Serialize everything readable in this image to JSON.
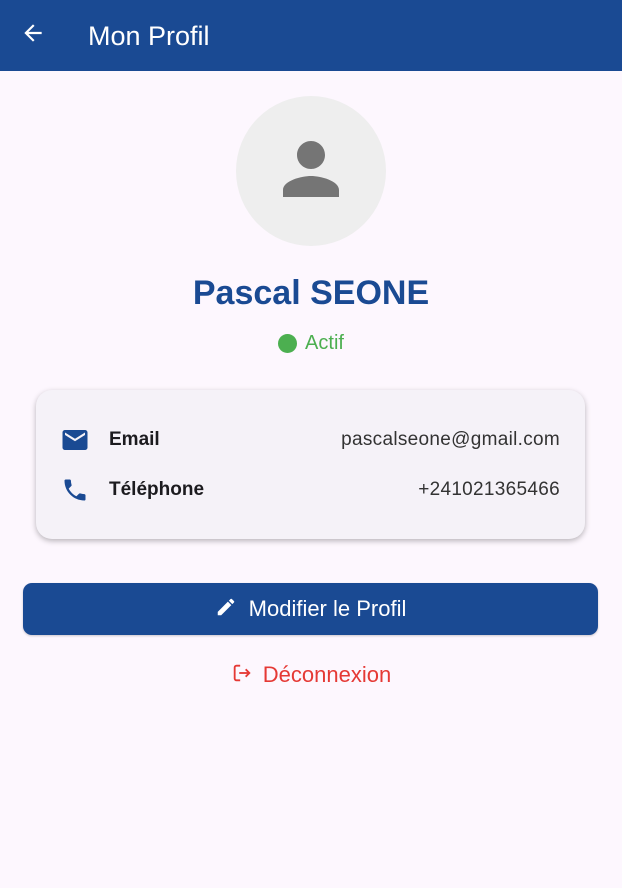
{
  "appbar": {
    "title": "Mon Profil",
    "back_icon": "arrow-back-icon",
    "color": "#1a4a93"
  },
  "profile": {
    "avatar_icon": "person-icon",
    "name": "Pascal SEONE",
    "status": "Actif",
    "status_color": "#4caf50"
  },
  "contact": {
    "email": {
      "icon": "mail-icon",
      "label": "Email",
      "value": "pascalseone@gmail.com"
    },
    "phone": {
      "icon": "phone-icon",
      "label": "Téléphone",
      "value": "+241021365466"
    }
  },
  "actions": {
    "edit": {
      "icon": "edit-icon",
      "label": "Modifier le Profil"
    },
    "logout": {
      "icon": "logout-icon",
      "label": "Déconnexion",
      "color": "#e53935"
    }
  }
}
